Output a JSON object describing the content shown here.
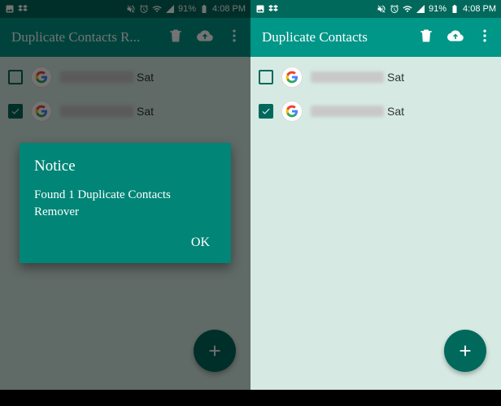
{
  "status": {
    "battery": "91%",
    "time": "4:08 PM"
  },
  "appbar": {
    "title_truncated": "Duplicate Contacts R...",
    "title": "Duplicate Contacts"
  },
  "contacts": [
    {
      "checked": false,
      "suffix": "Sat"
    },
    {
      "checked": true,
      "suffix": "Sat"
    }
  ],
  "dialog": {
    "title": "Notice",
    "body": "Found 1 Duplicate Contacts Remover",
    "ok": "OK"
  }
}
